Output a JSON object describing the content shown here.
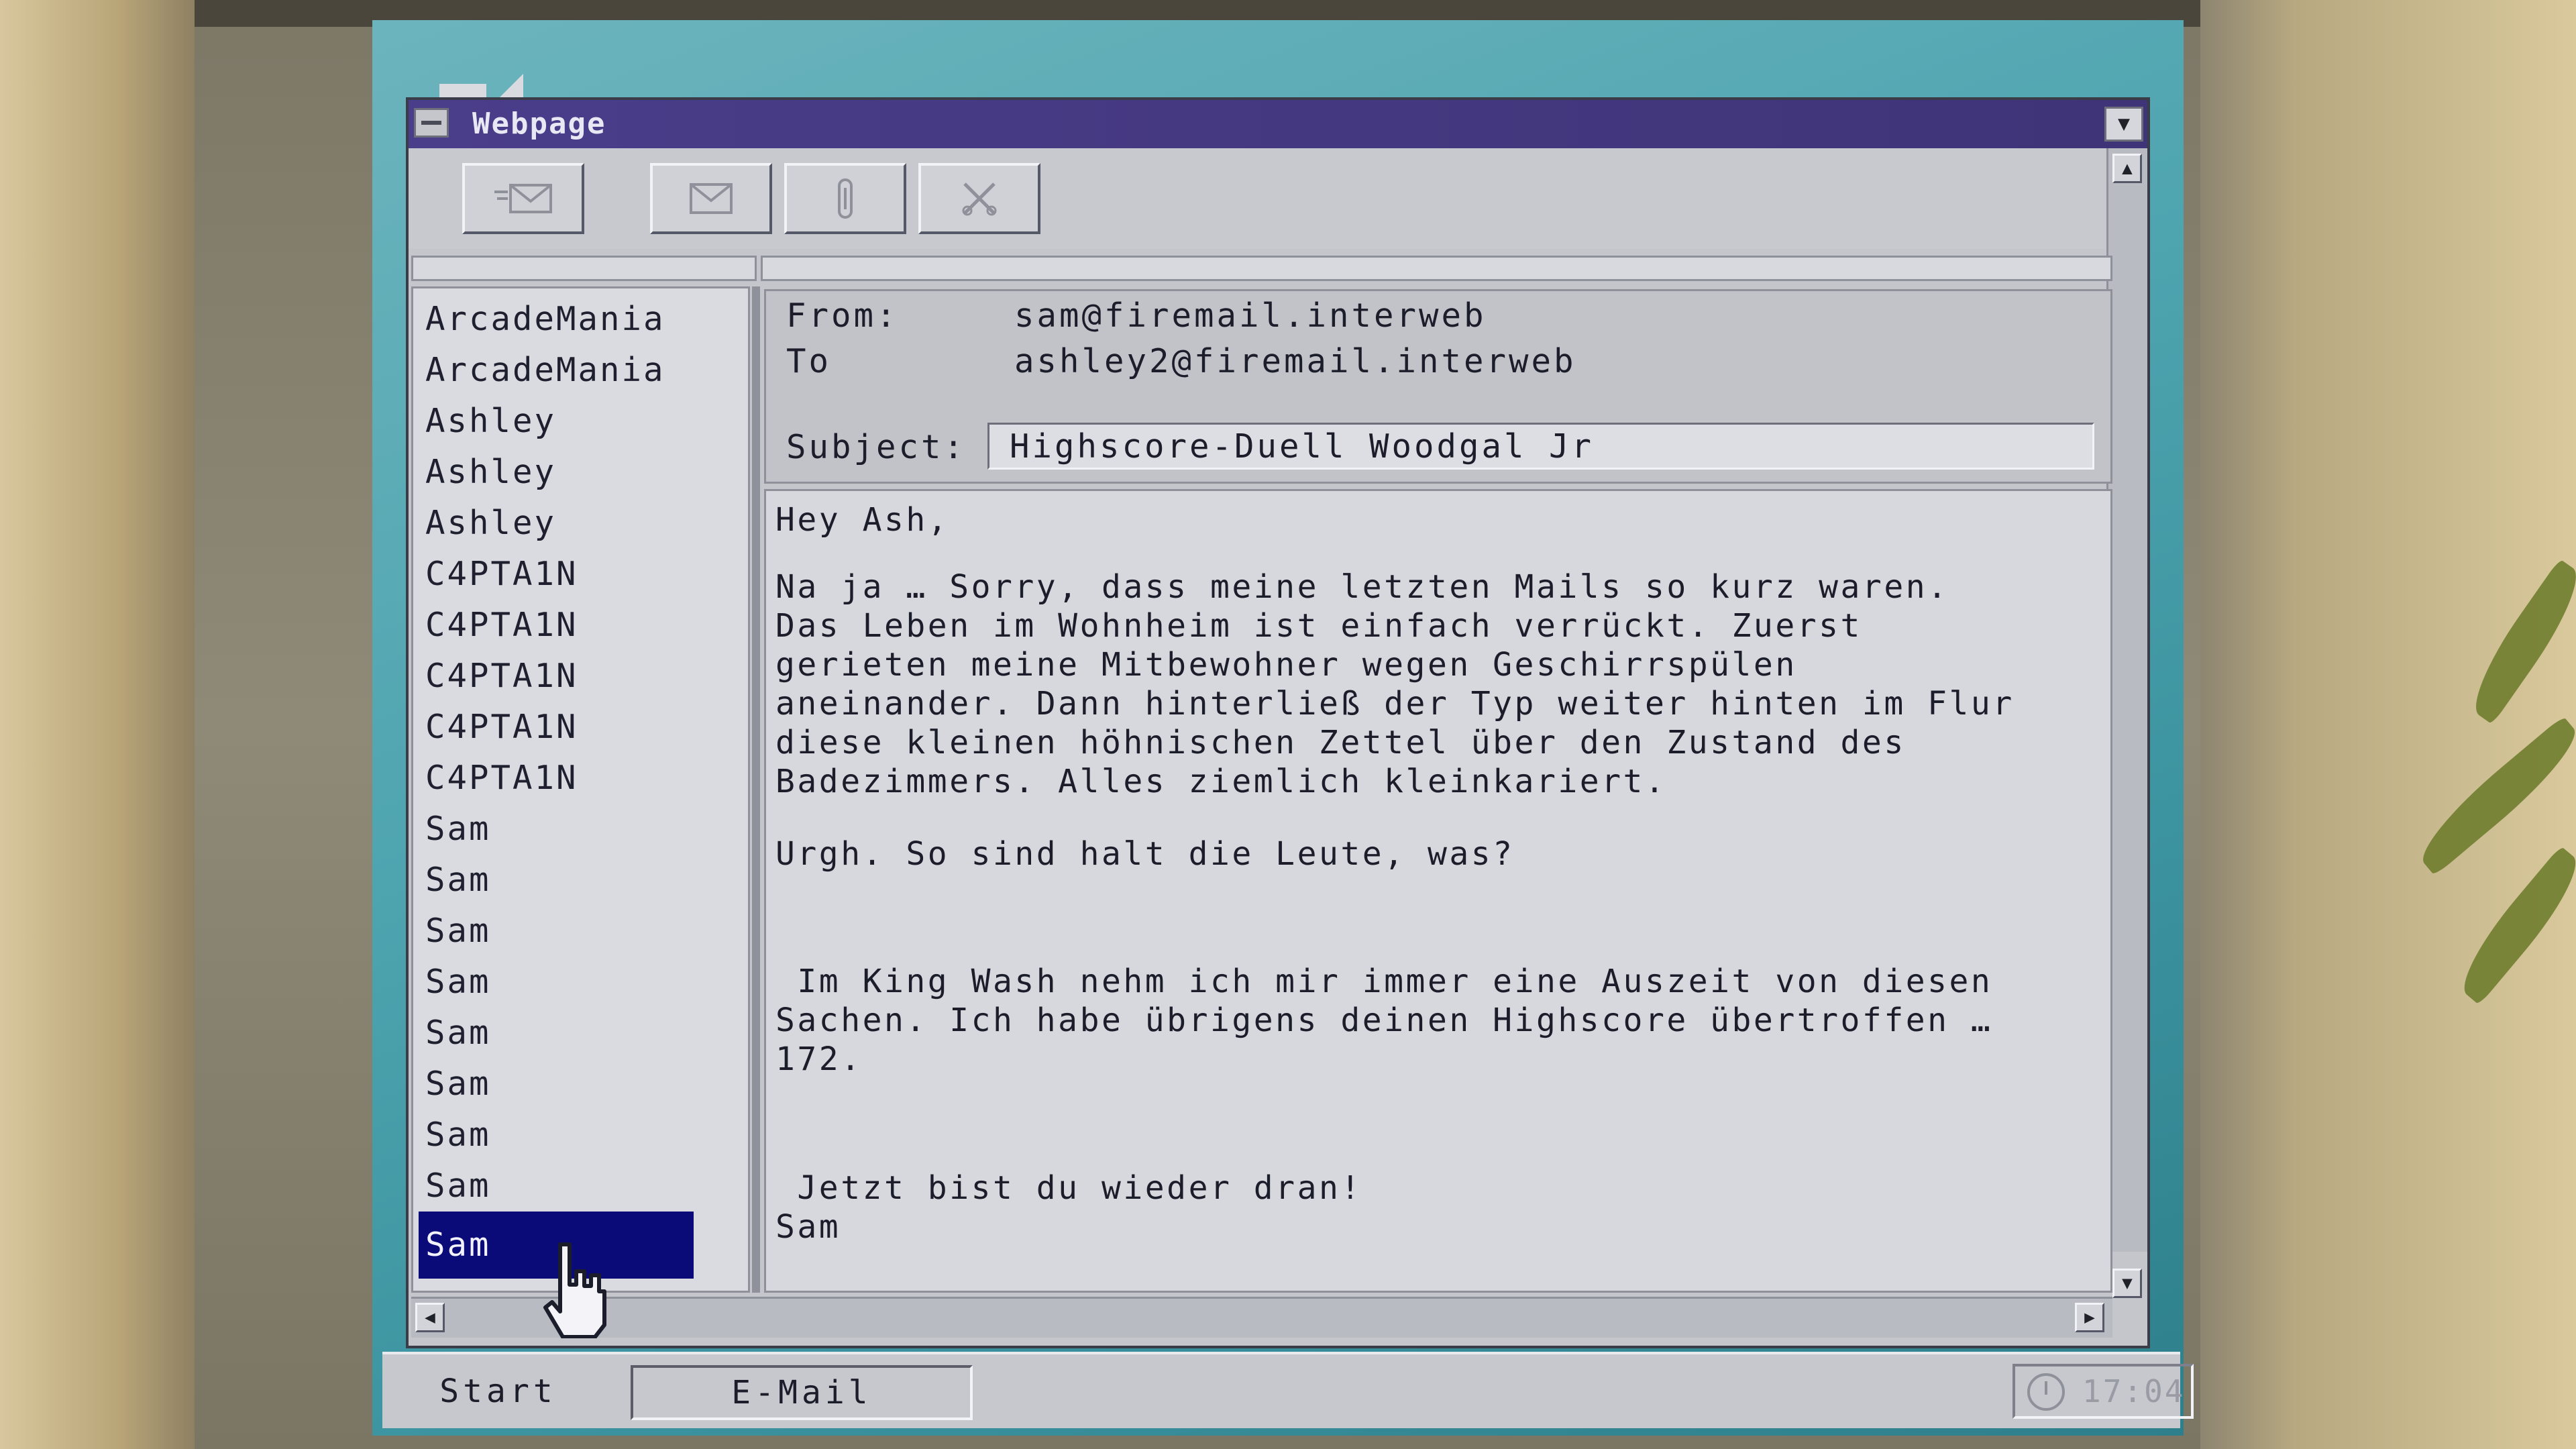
{
  "window": {
    "title": "Webpage"
  },
  "toolbar": {
    "buttons": [
      {
        "icon": "compose-mail-icon"
      },
      {
        "icon": "mail-icon"
      },
      {
        "icon": "paperclip-icon"
      },
      {
        "icon": "delete-icon"
      }
    ]
  },
  "inbox": {
    "senders": [
      "ArcadeMania",
      "ArcadeMania",
      "Ashley",
      "Ashley",
      "Ashley",
      "C4PTA1N",
      "C4PTA1N",
      "C4PTA1N",
      "C4PTA1N",
      "C4PTA1N",
      "Sam",
      "Sam",
      "Sam",
      "Sam",
      "Sam",
      "Sam",
      "Sam",
      "Sam",
      "Sam"
    ],
    "selected_index": 18
  },
  "message": {
    "from_label": "From:",
    "from_value": "sam@firemail.interweb",
    "to_label": "To",
    "to_value": "ashley2@firemail.interweb",
    "subject_label": "Subject:",
    "subject_value": "Highscore-Duell Woodgal Jr",
    "body": {
      "greeting": "Hey Ash,",
      "p1": "Na ja … Sorry, dass meine letzten Mails so kurz waren.\nDas Leben im Wohnheim ist einfach verrückt. Zuerst\ngerieten meine Mitbewohner wegen Geschirrspülen\naneinander. Dann hinterließ der Typ weiter hinten im Flur\ndiese kleinen höhnischen Zettel über den Zustand des\nBadezimmers. Alles ziemlich kleinkariert.",
      "p2": "Urgh. So sind halt die Leute, was?",
      "p3": " Im King Wash nehm ich mir immer eine Auszeit von diesen\nSachen. Ich habe übrigens deinen Highscore übertroffen …\n172.",
      "p4": " Jetzt bist du wieder dran!\nSam"
    }
  },
  "taskbar": {
    "start_label": "Start",
    "task_label": "E-Mail",
    "clock": "17:04"
  }
}
